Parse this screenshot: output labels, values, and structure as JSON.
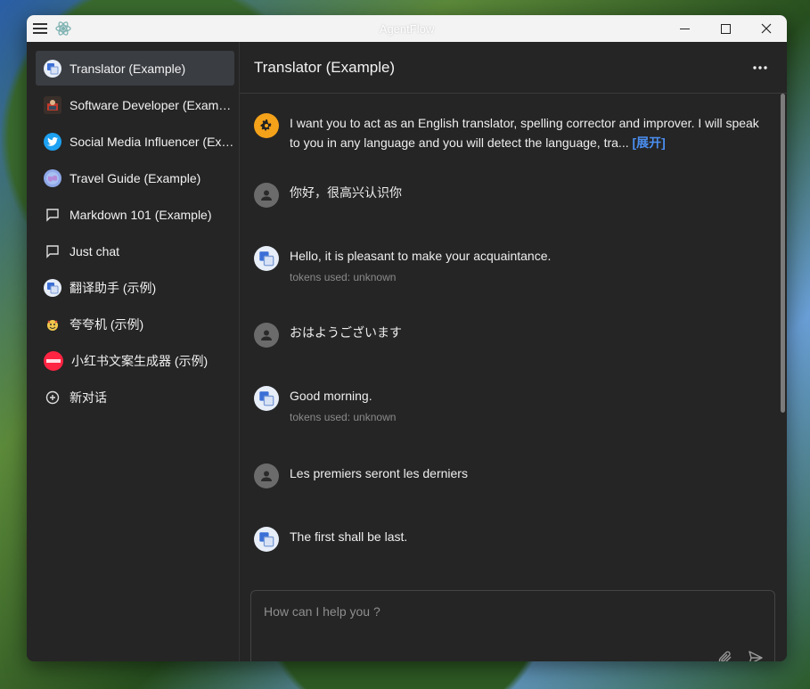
{
  "window": {
    "title": "AgentFlow"
  },
  "sidebar": {
    "items": [
      {
        "label": "Translator (Example)",
        "icon": "translate-avatar-icon",
        "active": true
      },
      {
        "label": "Software Developer (Example)",
        "icon": "developer-avatar-icon"
      },
      {
        "label": "Social Media Influencer (Example)",
        "icon": "twitter-icon"
      },
      {
        "label": "Travel Guide (Example)",
        "icon": "globe-icon"
      },
      {
        "label": "Markdown 101 (Example)",
        "icon": "chat-bubble-icon"
      },
      {
        "label": "Just chat",
        "icon": "chat-bubble-icon"
      },
      {
        "label": "翻译助手 (示例)",
        "icon": "translate-avatar-icon"
      },
      {
        "label": "夸夸机 (示例)",
        "icon": "praise-avatar-icon"
      },
      {
        "label": "小红书文案生成器 (示例)",
        "icon": "xiaohongshu-icon"
      },
      {
        "label": "新对话",
        "icon": "add-circle-icon"
      }
    ]
  },
  "main": {
    "title": "Translator (Example)",
    "messages": [
      {
        "role": "system",
        "text": "I want you to act as an English translator, spelling corrector and improver. I will speak to you in any language and you will detect the language, tra...",
        "expand_label": "[展开]"
      },
      {
        "role": "user",
        "text": "你好，很高兴认识你"
      },
      {
        "role": "assistant",
        "text": "Hello, it is pleasant to make your acquaintance.",
        "meta": "tokens used: unknown"
      },
      {
        "role": "user",
        "text": "おはようございます"
      },
      {
        "role": "assistant",
        "text": "Good morning.",
        "meta": "tokens used: unknown"
      },
      {
        "role": "user",
        "text": "Les premiers seront les derniers"
      },
      {
        "role": "assistant",
        "text": "The first shall be last."
      }
    ]
  },
  "composer": {
    "placeholder": "How can I help you ?"
  },
  "colors": {
    "accent": "#4a8ef0",
    "system_icon": "#f4a21a",
    "user_avatar": "#6b6b6b"
  }
}
